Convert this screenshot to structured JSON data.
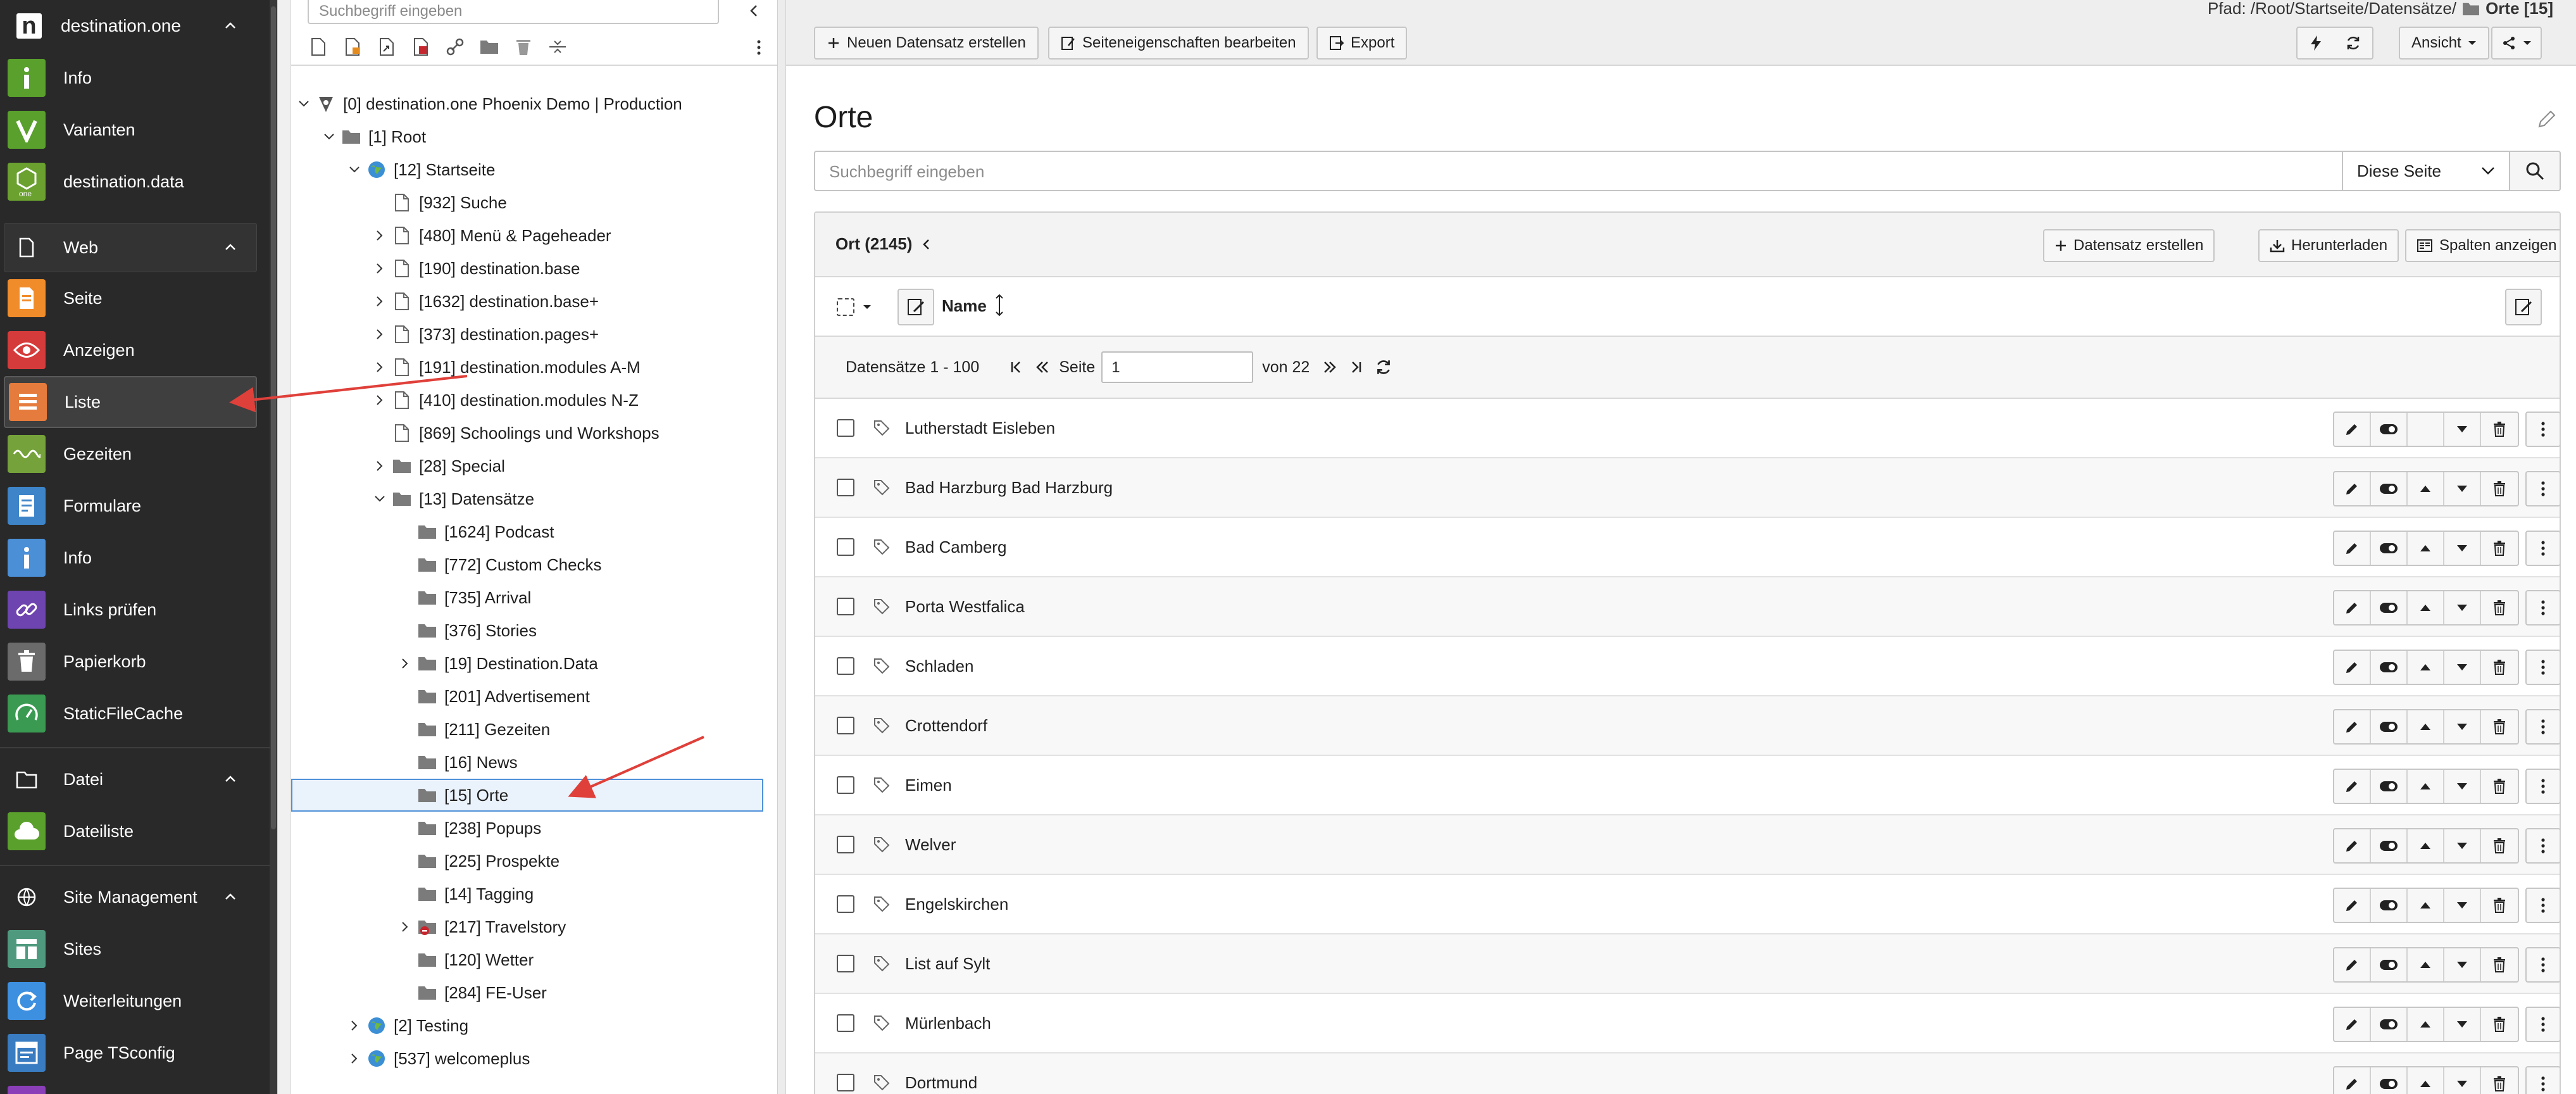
{
  "modmenu": {
    "brand": {
      "logo": "n",
      "name": "destination.one"
    },
    "top_items": [
      {
        "label": "Info",
        "icon": "info-icon",
        "color": "#5aa02c"
      },
      {
        "label": "Varianten",
        "icon": "v-icon",
        "color": "#5aa02c"
      },
      {
        "label": "destination.data",
        "icon": "data-icon",
        "color": "#6aa12f"
      }
    ],
    "groups": [
      {
        "label": "Web",
        "icon": "page-icon"
      },
      {
        "label": "Datei",
        "icon": "file-icon"
      },
      {
        "label": "Site Management",
        "icon": "globe-icon"
      }
    ],
    "web_items": [
      {
        "label": "Seite",
        "icon": "page-module-icon",
        "color": "#f18c2a"
      },
      {
        "label": "Anzeigen",
        "icon": "eye-icon",
        "color": "#d63b3b"
      },
      {
        "label": "Liste",
        "icon": "list-icon",
        "color": "#e57b3c"
      },
      {
        "label": "Gezeiten",
        "icon": "wave-icon",
        "color": "#75a23a"
      },
      {
        "label": "Formulare",
        "icon": "form-icon",
        "color": "#3e84c9"
      },
      {
        "label": "Info",
        "icon": "info-icon",
        "color": "#4b8fd6"
      },
      {
        "label": "Links prüfen",
        "icon": "link-icon",
        "color": "#6e44b0"
      },
      {
        "label": "Papierkorb",
        "icon": "trash-icon",
        "color": "#6b6b6b"
      },
      {
        "label": "StaticFileCache",
        "icon": "gauge-icon",
        "color": "#3a9a52"
      }
    ],
    "datei_items": [
      {
        "label": "Dateiliste",
        "icon": "cloud-icon",
        "color": "#5aa02c"
      }
    ],
    "site_items": [
      {
        "label": "Sites",
        "icon": "sites-icon",
        "color": "#4f9a7e"
      },
      {
        "label": "Weiterleitungen",
        "icon": "redirect-icon",
        "color": "#3d8fe0"
      },
      {
        "label": "Page TSconfig",
        "icon": "tsconfig-icon",
        "color": "#3a7cc1"
      }
    ]
  },
  "tree": {
    "search_placeholder": "Suchbegriff eingeben",
    "nodes": [
      {
        "label": "[0] destination.one Phoenix Demo | Production",
        "depth": 0,
        "toggle": "open",
        "icon": "root-icon"
      },
      {
        "label": "[1] Root",
        "depth": 1,
        "toggle": "open",
        "icon": "folder-icon"
      },
      {
        "label": "[12] Startseite",
        "depth": 2,
        "toggle": "open",
        "icon": "globe-page-icon"
      },
      {
        "label": "[932] Suche",
        "depth": 3,
        "toggle": "none",
        "icon": "page-icon"
      },
      {
        "label": "[480] Menü & Pageheader",
        "depth": 3,
        "toggle": "closed",
        "icon": "page-icon"
      },
      {
        "label": "[190] destination.base",
        "depth": 3,
        "toggle": "closed",
        "icon": "page-icon"
      },
      {
        "label": "[1632] destination.base+",
        "depth": 3,
        "toggle": "closed",
        "icon": "page-icon"
      },
      {
        "label": "[373] destination.pages+",
        "depth": 3,
        "toggle": "closed",
        "icon": "page-icon"
      },
      {
        "label": "[191] destination.modules A-M",
        "depth": 3,
        "toggle": "closed",
        "icon": "page-icon"
      },
      {
        "label": "[410] destination.modules N-Z",
        "depth": 3,
        "toggle": "closed",
        "icon": "page-icon"
      },
      {
        "label": "[869] Schoolings und Workshops",
        "depth": 3,
        "toggle": "none",
        "icon": "page-icon"
      },
      {
        "label": "[28] Special",
        "depth": 3,
        "toggle": "closed",
        "icon": "folder-icon"
      },
      {
        "label": "[13] Datensätze",
        "depth": 3,
        "toggle": "open",
        "icon": "folder-icon"
      },
      {
        "label": "[1624] Podcast",
        "depth": 4,
        "toggle": "none",
        "icon": "folder-icon"
      },
      {
        "label": "[772] Custom Checks",
        "depth": 4,
        "toggle": "none",
        "icon": "folder-icon"
      },
      {
        "label": "[735] Arrival",
        "depth": 4,
        "toggle": "none",
        "icon": "folder-icon"
      },
      {
        "label": "[376] Stories",
        "depth": 4,
        "toggle": "none",
        "icon": "folder-icon"
      },
      {
        "label": "[19] Destination.Data",
        "depth": 4,
        "toggle": "closed",
        "icon": "folder-icon"
      },
      {
        "label": "[201] Advertisement",
        "depth": 4,
        "toggle": "none",
        "icon": "folder-icon"
      },
      {
        "label": "[211] Gezeiten",
        "depth": 4,
        "toggle": "none",
        "icon": "folder-icon"
      },
      {
        "label": "[16] News",
        "depth": 4,
        "toggle": "none",
        "icon": "folder-icon"
      },
      {
        "label": "[15] Orte",
        "depth": 4,
        "toggle": "none",
        "icon": "folder-icon"
      },
      {
        "label": "[238] Popups",
        "depth": 4,
        "toggle": "none",
        "icon": "folder-icon"
      },
      {
        "label": "[225] Prospekte",
        "depth": 4,
        "toggle": "none",
        "icon": "folder-icon"
      },
      {
        "label": "[14] Tagging",
        "depth": 4,
        "toggle": "none",
        "icon": "folder-icon"
      },
      {
        "label": "[217] Travelstory",
        "depth": 4,
        "toggle": "closed",
        "icon": "folder-restricted-icon"
      },
      {
        "label": "[120] Wetter",
        "depth": 4,
        "toggle": "none",
        "icon": "folder-icon"
      },
      {
        "label": "[284] FE-User",
        "depth": 4,
        "toggle": "none",
        "icon": "folder-icon"
      },
      {
        "label": "[2] Testing",
        "depth": 2,
        "toggle": "closed",
        "icon": "globe-page-icon"
      },
      {
        "label": "[537] welcomeplus",
        "depth": 2,
        "toggle": "closed",
        "icon": "globe-page-icon"
      }
    ]
  },
  "header": {
    "path_label": "Pfad: /Root/Startseite/Datensätze/",
    "path_current": "Orte [15]",
    "buttons": {
      "new_record": "Neuen Datensatz erstellen",
      "page_props": "Seiteneigenschaften bearbeiten",
      "export": "Export",
      "view": "Ansicht"
    }
  },
  "main": {
    "title": "Orte",
    "search_placeholder": "Suchbegriff eingeben",
    "search_scope": "Diese Seite",
    "table": {
      "title": "Ort (2145)",
      "create_button": "Datensatz erstellen",
      "download_button": "Herunterladen",
      "columns_button": "Spalten anzeigen",
      "column_name": "Name",
      "pager": {
        "range": "Datensätze 1 - 100",
        "page_label": "Seite",
        "page_value": "1",
        "of_label": "von 22"
      },
      "rows": [
        "Lutherstadt Eisleben",
        "Bad Harzburg Bad Harzburg",
        "Bad Camberg",
        "Porta Westfalica",
        "Schladen",
        "Crottendorf",
        "Eimen",
        "Welver",
        "Engelskirchen",
        "List auf Sylt",
        "Mürlenbach",
        "Dortmund"
      ]
    }
  },
  "colors": {
    "sidebar_bg": "#292929",
    "docheader_bg": "#eeeeee",
    "selected_border": "#4e90d9",
    "annotation_arrow": "#e0403a"
  }
}
